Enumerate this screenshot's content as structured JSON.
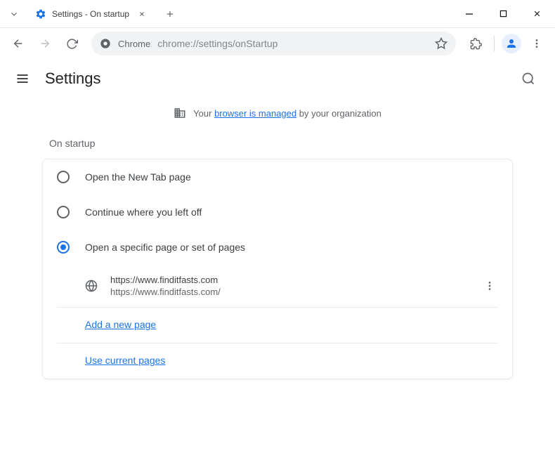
{
  "window": {
    "tab_title": "Settings - On startup"
  },
  "toolbar": {
    "chrome_chip": "Chrome",
    "url": "chrome://settings/onStartup"
  },
  "header": {
    "title": "Settings"
  },
  "banner": {
    "prefix": "Your ",
    "link": "browser is managed",
    "suffix": " by your organization"
  },
  "section": {
    "title": "On startup",
    "options": [
      {
        "label": "Open the New Tab page",
        "checked": false
      },
      {
        "label": "Continue where you left off",
        "checked": false
      },
      {
        "label": "Open a specific page or set of pages",
        "checked": true
      }
    ],
    "pages": [
      {
        "title": "https://www.finditfasts.com",
        "url": "https://www.finditfasts.com/"
      }
    ],
    "add_link": "Add a new page",
    "use_current_link": "Use current pages"
  }
}
